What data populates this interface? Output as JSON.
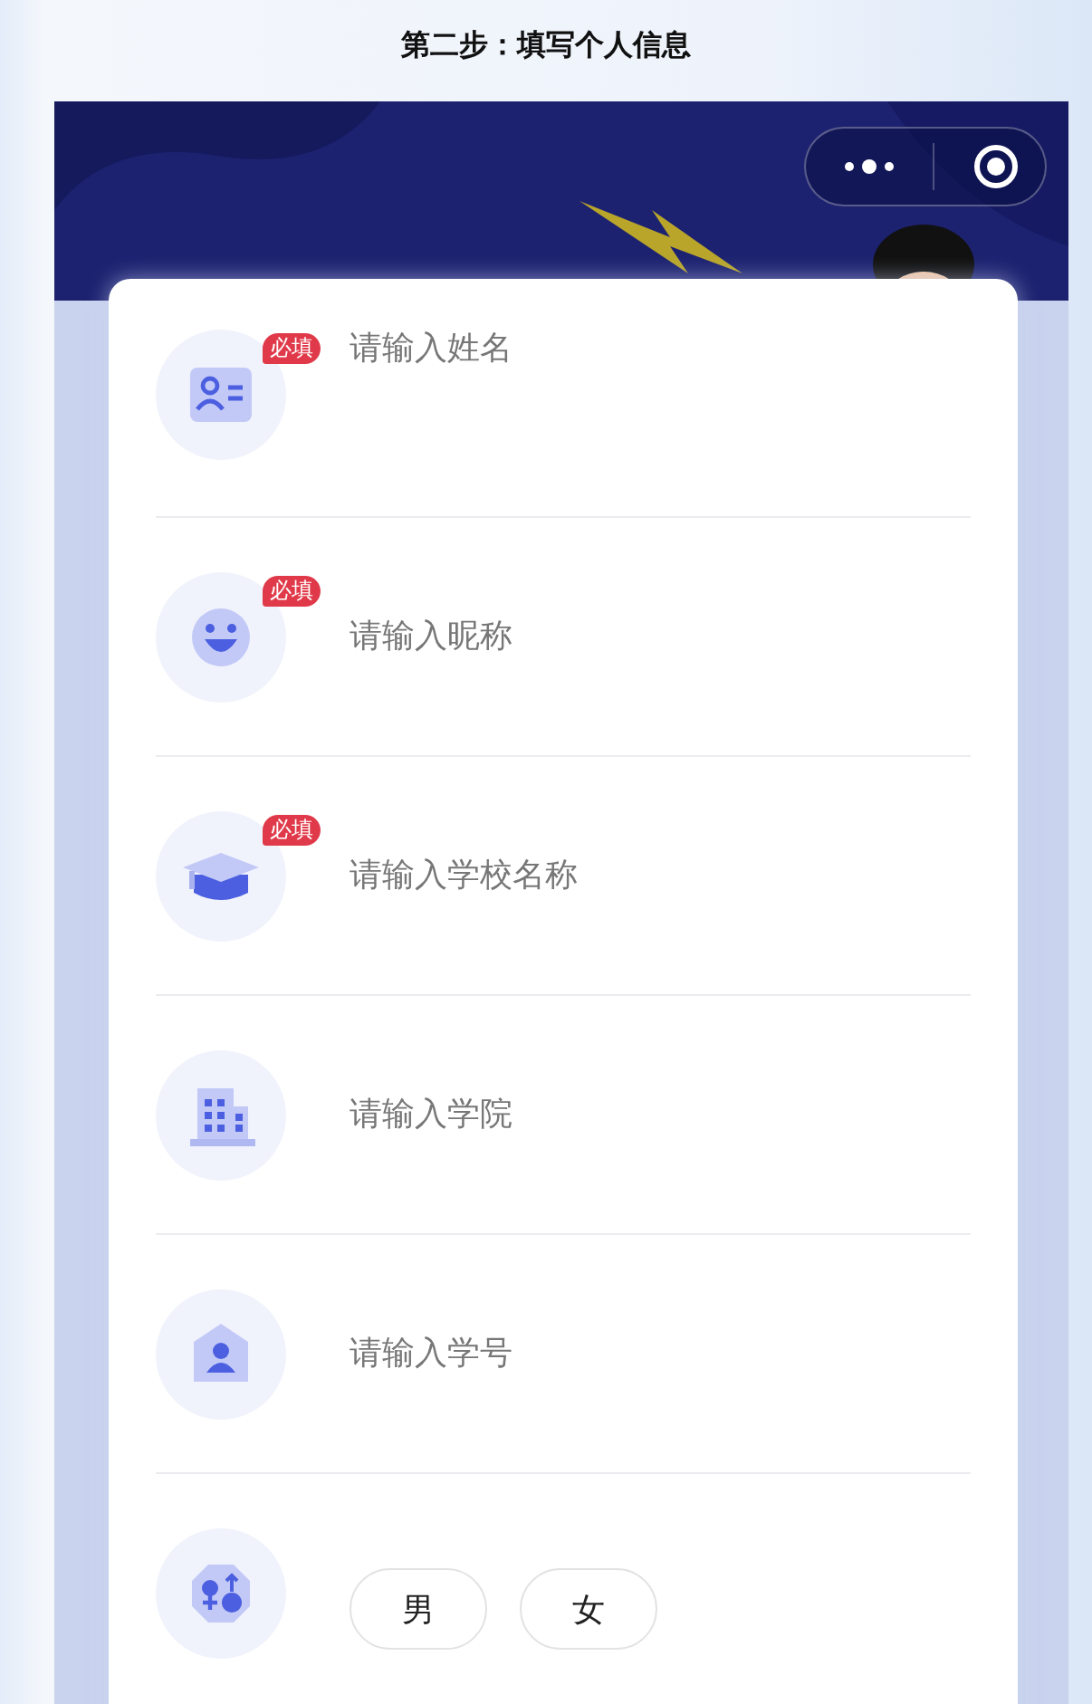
{
  "title": "第二步：填写个人信息",
  "fields": [
    {
      "kind": "text",
      "placeholder": "请输入姓名",
      "required_label": "必填"
    },
    {
      "kind": "text",
      "placeholder": "请输入昵称",
      "required_label": "必填"
    },
    {
      "kind": "text",
      "placeholder": "请输入学校名称",
      "required_label": "必填"
    },
    {
      "kind": "text",
      "placeholder": "请输入学院"
    },
    {
      "kind": "text",
      "placeholder": "请输入学号"
    },
    {
      "kind": "choice",
      "options": [
        {
          "label": "男",
          "selected": false
        },
        {
          "label": "女",
          "selected": false
        }
      ]
    }
  ]
}
